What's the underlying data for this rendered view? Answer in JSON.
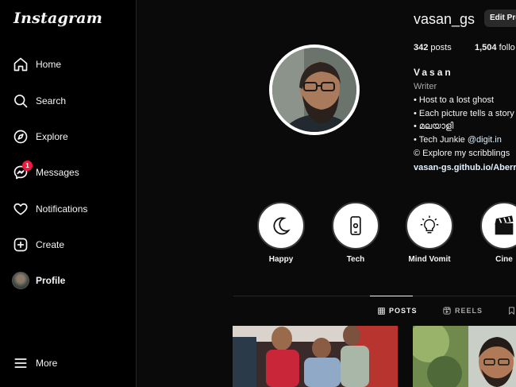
{
  "sidebar": {
    "logo": "Instagram",
    "items": [
      {
        "label": "Home",
        "icon": "home-icon"
      },
      {
        "label": "Search",
        "icon": "search-icon"
      },
      {
        "label": "Explore",
        "icon": "compass-icon"
      },
      {
        "label": "Messages",
        "icon": "messenger-icon",
        "badge": "1"
      },
      {
        "label": "Notifications",
        "icon": "heart-icon"
      },
      {
        "label": "Create",
        "icon": "plus-square-icon"
      },
      {
        "label": "Profile",
        "icon": "avatar"
      }
    ],
    "more_label": "More"
  },
  "profile": {
    "username": "vasan_gs",
    "edit_button": "Edit Pro",
    "posts_count": "342",
    "posts_label": "posts",
    "followers_count": "1,504",
    "followers_label": "follo",
    "full_name": "Vasan",
    "category": "Writer",
    "bio": [
      "• Host to a lost ghost",
      "• Each picture tells a story",
      "• മലയാളി"
    ],
    "bio_tech_prefix": "• Tech Junkie ",
    "bio_tech_mention": "@digit.in",
    "bio_explore": "© Explore my scribblings",
    "link": "vasan-gs.github.io/Aberra"
  },
  "highlights": [
    {
      "label": "Happy",
      "icon": "moon-icon"
    },
    {
      "label": "Tech",
      "icon": "phone-icon"
    },
    {
      "label": "Mind Vomit",
      "icon": "lightbulb-icon"
    },
    {
      "label": "Cine",
      "icon": "clapperboard-icon"
    }
  ],
  "tabs": [
    {
      "label": "POSTS",
      "icon": "grid-icon",
      "active": true
    },
    {
      "label": "REELS",
      "icon": "reels-icon",
      "active": false
    }
  ],
  "colors": {
    "background": "#000000",
    "badge": "#ed1a3d",
    "link": "#e0f1ff",
    "muted": "#a8a8a8"
  }
}
